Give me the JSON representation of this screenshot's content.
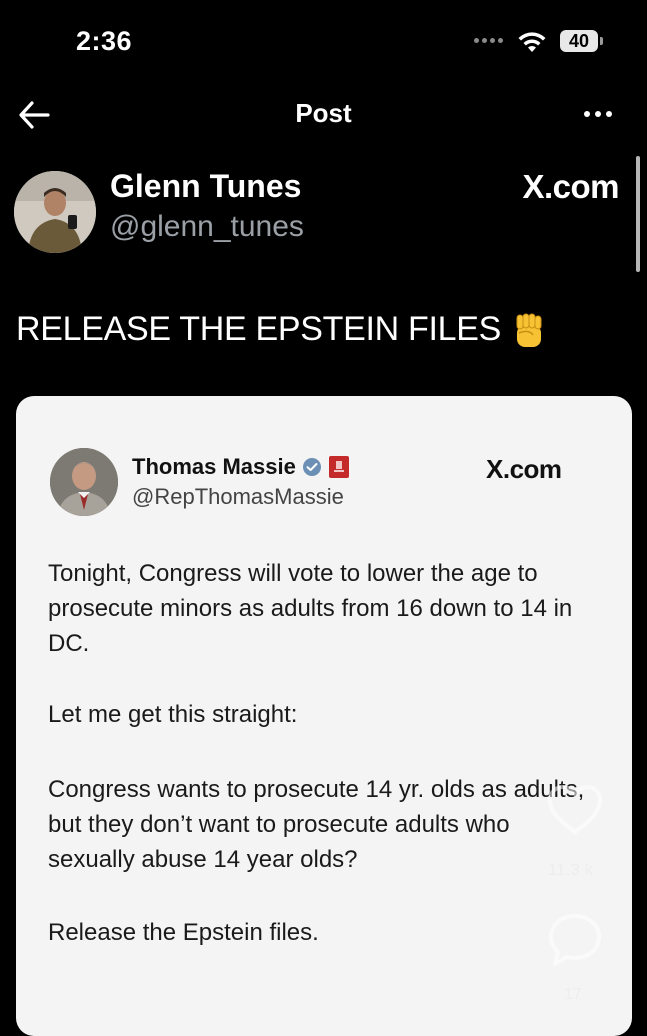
{
  "status_bar": {
    "time": "2:36",
    "battery": "40"
  },
  "nav": {
    "title": "Post"
  },
  "post": {
    "author_name": "Glenn Tunes",
    "author_handle": "@glenn_tunes",
    "source": "X.com",
    "text": "RELEASE THE EPSTEIN FILES"
  },
  "embedded_post": {
    "author_name": "Thomas Massie",
    "author_handle": "@RepThomasMassie",
    "source": "X.com",
    "paragraphs": [
      "Tonight, Congress will vote to lower the age to prosecute minors as adults from 16 down to 14 in DC.",
      "Let me get this straight:",
      "Congress wants to prosecute 14 yr. olds as adults, but they don’t want to prosecute adults who sexually abuse 14 year olds?",
      "Release the Epstein files."
    ]
  },
  "overlay": {
    "like_count": "11.3 k",
    "comment_count": "17"
  },
  "colors": {
    "background": "#000000",
    "card": "#f4f4f4",
    "handle_gray": "#9aa0a6",
    "verified_blue": "#1d9bf0"
  }
}
